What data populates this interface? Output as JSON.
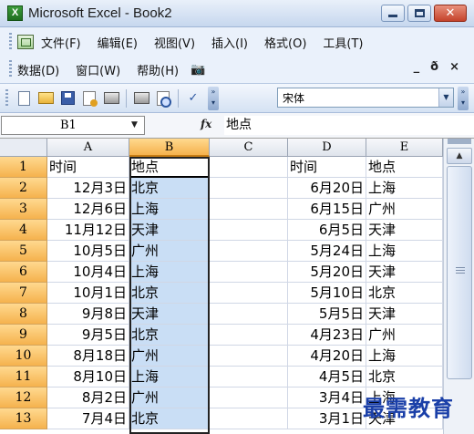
{
  "window": {
    "title": "Microsoft Excel - Book2",
    "app_icon": "X"
  },
  "menu": {
    "row1": [
      "文件(F)",
      "编辑(E)",
      "视图(V)",
      "插入(I)",
      "格式(O)",
      "工具(T)"
    ],
    "row2": [
      "数据(D)",
      "窗口(W)",
      "帮助(H)"
    ],
    "mdi": {
      "min": "_",
      "restore": "ð",
      "close": "×"
    }
  },
  "toolbar": {
    "font_name": "宋体"
  },
  "formula_bar": {
    "name_box": "B1",
    "fx": "fx",
    "value": "地点"
  },
  "columns": [
    "A",
    "B",
    "C",
    "D",
    "E"
  ],
  "selected_column": "B",
  "rows": [
    {
      "num": "1",
      "A": "时间",
      "B": "地点",
      "C": "",
      "D": "时间",
      "E": "地点"
    },
    {
      "num": "2",
      "A": "12月3日",
      "B": "北京",
      "C": "",
      "D": "6月20日",
      "E": "上海"
    },
    {
      "num": "3",
      "A": "12月6日",
      "B": "上海",
      "C": "",
      "D": "6月15日",
      "E": "广州"
    },
    {
      "num": "4",
      "A": "11月12日",
      "B": "天津",
      "C": "",
      "D": "6月5日",
      "E": "天津"
    },
    {
      "num": "5",
      "A": "10月5日",
      "B": "广州",
      "C": "",
      "D": "5月24日",
      "E": "上海"
    },
    {
      "num": "6",
      "A": "10月4日",
      "B": "上海",
      "C": "",
      "D": "5月20日",
      "E": "天津"
    },
    {
      "num": "7",
      "A": "10月1日",
      "B": "北京",
      "C": "",
      "D": "5月10日",
      "E": "北京"
    },
    {
      "num": "8",
      "A": "9月8日",
      "B": "天津",
      "C": "",
      "D": "5月5日",
      "E": "天津"
    },
    {
      "num": "9",
      "A": "9月5日",
      "B": "北京",
      "C": "",
      "D": "4月23日",
      "E": "广州"
    },
    {
      "num": "10",
      "A": "8月18日",
      "B": "广州",
      "C": "",
      "D": "4月20日",
      "E": "上海"
    },
    {
      "num": "11",
      "A": "8月10日",
      "B": "上海",
      "C": "",
      "D": "4月5日",
      "E": "北京"
    },
    {
      "num": "12",
      "A": "8月2日",
      "B": "广州",
      "C": "",
      "D": "3月4日",
      "E": "上海"
    },
    {
      "num": "13",
      "A": "7月4日",
      "B": "北京",
      "C": "",
      "D": "3月1日",
      "E": "天津"
    }
  ],
  "watermark": "最需教育"
}
